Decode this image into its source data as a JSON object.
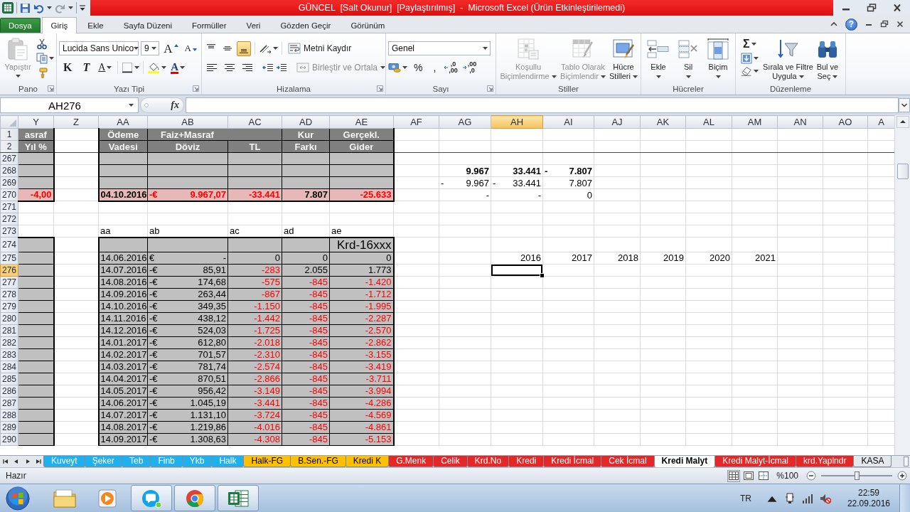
{
  "title_bar": {
    "title": "GÜNCEL  [Salt Okunur]  [Paylaştırılmış]  -  Microsoft Excel (Ürün Etkinleştirilemedi)",
    "quick_access": [
      {
        "kind": "save",
        "disabled": false
      },
      {
        "kind": "undo",
        "disabled": false
      },
      {
        "kind": "redo",
        "disabled": true
      }
    ]
  },
  "ribbon": {
    "tabs": [
      {
        "label": "Dosya",
        "kind": "file",
        "selected": false
      },
      {
        "label": "Giriş",
        "kind": "tab",
        "selected": true
      },
      {
        "label": "Ekle",
        "kind": "tab",
        "selected": false
      },
      {
        "label": "Sayfa Düzeni",
        "kind": "tab",
        "selected": false
      },
      {
        "label": "Formüller",
        "kind": "tab",
        "selected": false
      },
      {
        "label": "Veri",
        "kind": "tab",
        "selected": false
      },
      {
        "label": "Gözden Geçir",
        "kind": "tab",
        "selected": false
      },
      {
        "label": "Görünüm",
        "kind": "tab",
        "selected": false
      }
    ],
    "help": "?",
    "clipboard": {
      "label": "Pano",
      "launcher": true,
      "paste": {
        "label": "Yapıştır",
        "disabled": true
      }
    },
    "font": {
      "label": "Yazı Tipi",
      "launcher": true,
      "name": "Lucida Sans Unico",
      "size": "9",
      "buttons": {
        "grow_font": "A",
        "shrink_font": "A",
        "bold": "K",
        "italic": "T",
        "underline": "A",
        "font_color": "A"
      }
    },
    "alignment": {
      "label": "Hizalama",
      "launcher": true,
      "vertical": [
        {
          "selected": false
        },
        {
          "selected": false
        },
        {
          "selected": true
        }
      ],
      "horizontal": [
        {
          "selected": false
        },
        {
          "selected": false
        },
        {
          "selected": false
        }
      ],
      "wrap_text": {
        "label": "Metni Kaydır",
        "disabled": false
      },
      "merge": {
        "label": "Birleştir ve Ortala",
        "disabled": true
      }
    },
    "number": {
      "label": "Sayı",
      "launcher": true,
      "format": "Genel",
      "percent": "%",
      "comma": ",",
      "decimals": [
        {
          "lines": [
            ",0",
            ",00"
          ]
        },
        {
          "lines": [
            ",00",
            ",0"
          ]
        }
      ]
    },
    "styles": {
      "label": "Stiller",
      "buttons": [
        {
          "lines": [
            "Koşullu",
            "Biçimlendirme"
          ],
          "disabled": true
        },
        {
          "lines": [
            "Tablo Olarak",
            "Biçimlendir"
          ],
          "disabled": true
        },
        {
          "lines": [
            "Hücre",
            "Stilleri"
          ],
          "disabled": false
        }
      ]
    },
    "cells": {
      "label": "Hücreler",
      "buttons": [
        {
          "label": "Ekle"
        },
        {
          "label": "Sil"
        },
        {
          "label": "Biçim"
        }
      ]
    },
    "editing": {
      "label": "Düzenleme",
      "sum": "Σ",
      "buttons": [
        {
          "lines": [
            "Sırala ve Filtre",
            "Uygula"
          ]
        },
        {
          "lines": [
            "Bul ve",
            "Seç"
          ]
        }
      ]
    }
  },
  "formula_bar": {
    "name_box": "AH276",
    "function": "fx"
  },
  "sheet": {
    "columns": [
      {
        "label": "Y",
        "selected": false
      },
      {
        "label": "Z",
        "selected": false
      },
      {
        "label": "AA",
        "selected": false
      },
      {
        "label": "AB",
        "selected": false
      },
      {
        "label": "AC",
        "selected": false
      },
      {
        "label": "AD",
        "selected": false
      },
      {
        "label": "AE",
        "selected": false
      },
      {
        "label": "AF",
        "selected": false
      },
      {
        "label": "AG",
        "selected": false
      },
      {
        "label": "AH",
        "selected": true
      },
      {
        "label": "AI",
        "selected": false
      },
      {
        "label": "AJ",
        "selected": false
      },
      {
        "label": "AK",
        "selected": false
      },
      {
        "label": "AL",
        "selected": false
      },
      {
        "label": "AM",
        "selected": false
      },
      {
        "label": "AN",
        "selected": false
      },
      {
        "label": "AO",
        "selected": false
      },
      {
        "label": "A",
        "selected": false
      }
    ],
    "rows": [
      {
        "number": "1",
        "selected": false,
        "cells": [
          {
            "kind": "header",
            "text": "asraf"
          },
          null,
          {
            "kind": "header",
            "text": "Ödeme"
          },
          {
            "kind": "header",
            "text": "Faiz+Masraf",
            "merge_right": true
          },
          null,
          {
            "kind": "header",
            "text": "Kur"
          },
          {
            "kind": "header",
            "text": "Gerçekl."
          }
        ]
      },
      {
        "number": "2",
        "selected": false,
        "cells": [
          {
            "kind": "header",
            "text": "Yıl %"
          },
          null,
          {
            "kind": "header",
            "text": "Vadesi"
          },
          {
            "kind": "header",
            "text": "Döviz"
          },
          {
            "kind": "header",
            "text": "TL"
          },
          {
            "kind": "header",
            "text": "Farkı"
          },
          {
            "kind": "header",
            "text": "Gider"
          }
        ]
      },
      {
        "number": "267",
        "selected": false,
        "cells": [
          {
            "kind": "shaded"
          },
          null,
          {
            "kind": "shaded"
          },
          {
            "kind": "shaded"
          },
          {
            "kind": "shaded"
          },
          {
            "kind": "shaded"
          },
          {
            "kind": "shaded"
          }
        ]
      },
      {
        "number": "268",
        "selected": false,
        "cells": [
          {
            "kind": "shaded"
          },
          null,
          {
            "kind": "shaded"
          },
          {
            "kind": "shaded"
          },
          {
            "kind": "shaded"
          },
          {
            "kind": "shaded"
          },
          {
            "kind": "shaded"
          },
          null,
          {
            "kind": "strong",
            "text": "9.967"
          },
          {
            "kind": "strong",
            "text": "33.441"
          },
          {
            "kind": "strong",
            "sign": "-",
            "text": "7.807"
          }
        ]
      },
      {
        "number": "269",
        "selected": false,
        "cells": [
          {
            "kind": "shaded"
          },
          null,
          {
            "kind": "shaded"
          },
          {
            "kind": "shaded"
          },
          {
            "kind": "shaded"
          },
          {
            "kind": "shaded"
          },
          {
            "kind": "shaded"
          },
          null,
          {
            "kind": "plain",
            "sign": "-",
            "text": "9.967"
          },
          {
            "kind": "plain",
            "sign": "-",
            "text": "33.441"
          },
          {
            "kind": "plain",
            "text": "7.807"
          }
        ]
      },
      {
        "number": "270",
        "selected": false,
        "cells": [
          {
            "kind": "total",
            "text": "-4,00",
            "color": "#ff0000"
          },
          null,
          {
            "kind": "total",
            "text": "04.10.2016"
          },
          {
            "kind": "total",
            "sign": "-€",
            "text": "9.967,07",
            "color": "#ff0000"
          },
          {
            "kind": "total",
            "text": "-33.441",
            "color": "#ff0000"
          },
          {
            "kind": "total",
            "text": "7.807"
          },
          {
            "kind": "total",
            "text": "-25.633",
            "color": "#ff0000"
          },
          null,
          {
            "kind": "plain",
            "text": "-"
          },
          {
            "kind": "plain",
            "text": "-"
          },
          {
            "kind": "plain",
            "text": "0"
          }
        ]
      },
      {
        "number": "271",
        "selected": false
      },
      {
        "number": "272",
        "selected": false
      },
      {
        "number": "273",
        "selected": false,
        "cells": [
          null,
          null,
          {
            "kind": "label",
            "text": "aa"
          },
          {
            "kind": "label",
            "text": "ab"
          },
          {
            "kind": "label",
            "text": "ac"
          },
          {
            "kind": "label",
            "text": "ad"
          },
          {
            "kind": "label",
            "text": "ae"
          }
        ]
      },
      {
        "number": "274",
        "selected": false,
        "cells": [
          {
            "kind": "shaded"
          },
          null,
          {
            "kind": "shaded"
          },
          {
            "kind": "shaded"
          },
          {
            "kind": "shaded"
          },
          {
            "kind": "shaded"
          },
          {
            "kind": "note",
            "text": "Krd-16xxx"
          }
        ]
      },
      {
        "number": "275",
        "selected": false,
        "cells": [
          {
            "kind": "shaded"
          },
          null,
          {
            "kind": "shaded",
            "text": "14.06.2016"
          },
          {
            "kind": "shaded",
            "sign": "€",
            "text": "-"
          },
          {
            "kind": "shaded",
            "text": "0"
          },
          {
            "kind": "shaded",
            "text": "0"
          },
          {
            "kind": "shaded",
            "text": "0"
          },
          null,
          null,
          {
            "kind": "plain",
            "text": "2016"
          },
          {
            "kind": "plain",
            "text": "2017"
          },
          {
            "kind": "plain",
            "text": "2018"
          },
          {
            "kind": "plain",
            "text": "2019"
          },
          {
            "kind": "plain",
            "text": "2020"
          },
          {
            "kind": "plain",
            "text": "2021"
          }
        ]
      },
      {
        "number": "276",
        "selected": true,
        "cells": [
          {
            "kind": "shaded"
          },
          null,
          {
            "kind": "shaded",
            "text": "14.07.2016"
          },
          {
            "kind": "shaded",
            "sign": "-€",
            "text": "85,91"
          },
          {
            "kind": "shaded",
            "text": "-283",
            "color": "#ff0000"
          },
          {
            "kind": "shaded",
            "text": "2.055"
          },
          {
            "kind": "shaded",
            "text": "1.773"
          }
        ]
      },
      {
        "number": "277",
        "selected": false,
        "cells": [
          {
            "kind": "shaded"
          },
          null,
          {
            "kind": "shaded",
            "text": "14.08.2016"
          },
          {
            "kind": "shaded",
            "sign": "-€",
            "text": "174,68"
          },
          {
            "kind": "shaded",
            "text": "-575",
            "color": "#ff0000"
          },
          {
            "kind": "shaded",
            "text": "-845",
            "color": "#ff0000"
          },
          {
            "kind": "shaded",
            "text": "-1.420",
            "color": "#ff0000"
          }
        ]
      },
      {
        "number": "278",
        "selected": false,
        "cells": [
          {
            "kind": "shaded"
          },
          null,
          {
            "kind": "shaded",
            "text": "14.09.2016"
          },
          {
            "kind": "shaded",
            "sign": "-€",
            "text": "263,44"
          },
          {
            "kind": "shaded",
            "text": "-867",
            "color": "#ff0000"
          },
          {
            "kind": "shaded",
            "text": "-845",
            "color": "#ff0000"
          },
          {
            "kind": "shaded",
            "text": "-1.712",
            "color": "#ff0000"
          }
        ]
      },
      {
        "number": "279",
        "selected": false,
        "cells": [
          {
            "kind": "shaded"
          },
          null,
          {
            "kind": "shaded",
            "text": "14.10.2016"
          },
          {
            "kind": "shaded",
            "sign": "-€",
            "text": "349,35"
          },
          {
            "kind": "shaded",
            "text": "-1.150",
            "color": "#ff0000"
          },
          {
            "kind": "shaded",
            "text": "-845",
            "color": "#ff0000"
          },
          {
            "kind": "shaded",
            "text": "-1.995",
            "color": "#ff0000"
          }
        ]
      },
      {
        "number": "280",
        "selected": false,
        "cells": [
          {
            "kind": "shaded"
          },
          null,
          {
            "kind": "shaded",
            "text": "14.11.2016"
          },
          {
            "kind": "shaded",
            "sign": "-€",
            "text": "438,12"
          },
          {
            "kind": "shaded",
            "text": "-1.442",
            "color": "#ff0000"
          },
          {
            "kind": "shaded",
            "text": "-845",
            "color": "#ff0000"
          },
          {
            "kind": "shaded",
            "text": "-2.287",
            "color": "#ff0000"
          }
        ]
      },
      {
        "number": "281",
        "selected": false,
        "cells": [
          {
            "kind": "shaded"
          },
          null,
          {
            "kind": "shaded",
            "text": "14.12.2016"
          },
          {
            "kind": "shaded",
            "sign": "-€",
            "text": "524,03"
          },
          {
            "kind": "shaded",
            "text": "-1.725",
            "color": "#ff0000"
          },
          {
            "kind": "shaded",
            "text": "-845",
            "color": "#ff0000"
          },
          {
            "kind": "shaded",
            "text": "-2.570",
            "color": "#ff0000"
          }
        ]
      },
      {
        "number": "282",
        "selected": false,
        "cells": [
          {
            "kind": "shaded"
          },
          null,
          {
            "kind": "shaded",
            "text": "14.01.2017"
          },
          {
            "kind": "shaded",
            "sign": "-€",
            "text": "612,80"
          },
          {
            "kind": "shaded",
            "text": "-2.018",
            "color": "#ff0000"
          },
          {
            "kind": "shaded",
            "text": "-845",
            "color": "#ff0000"
          },
          {
            "kind": "shaded",
            "text": "-2.862",
            "color": "#ff0000"
          }
        ]
      },
      {
        "number": "283",
        "selected": false,
        "cells": [
          {
            "kind": "shaded"
          },
          null,
          {
            "kind": "shaded",
            "text": "14.02.2017"
          },
          {
            "kind": "shaded",
            "sign": "-€",
            "text": "701,57"
          },
          {
            "kind": "shaded",
            "text": "-2.310",
            "color": "#ff0000"
          },
          {
            "kind": "shaded",
            "text": "-845",
            "color": "#ff0000"
          },
          {
            "kind": "shaded",
            "text": "-3.155",
            "color": "#ff0000"
          }
        ]
      },
      {
        "number": "284",
        "selected": false,
        "cells": [
          {
            "kind": "shaded"
          },
          null,
          {
            "kind": "shaded",
            "text": "14.03.2017"
          },
          {
            "kind": "shaded",
            "sign": "-€",
            "text": "781,74"
          },
          {
            "kind": "shaded",
            "text": "-2.574",
            "color": "#ff0000"
          },
          {
            "kind": "shaded",
            "text": "-845",
            "color": "#ff0000"
          },
          {
            "kind": "shaded",
            "text": "-3.419",
            "color": "#ff0000"
          }
        ]
      },
      {
        "number": "285",
        "selected": false,
        "cells": [
          {
            "kind": "shaded"
          },
          null,
          {
            "kind": "shaded",
            "text": "14.04.2017"
          },
          {
            "kind": "shaded",
            "sign": "-€",
            "text": "870,51"
          },
          {
            "kind": "shaded",
            "text": "-2.866",
            "color": "#ff0000"
          },
          {
            "kind": "shaded",
            "text": "-845",
            "color": "#ff0000"
          },
          {
            "kind": "shaded",
            "text": "-3.711",
            "color": "#ff0000"
          }
        ]
      },
      {
        "number": "286",
        "selected": false,
        "cells": [
          {
            "kind": "shaded"
          },
          null,
          {
            "kind": "shaded",
            "text": "14.05.2017"
          },
          {
            "kind": "shaded",
            "sign": "-€",
            "text": "956,42"
          },
          {
            "kind": "shaded",
            "text": "-3.149",
            "color": "#ff0000"
          },
          {
            "kind": "shaded",
            "text": "-845",
            "color": "#ff0000"
          },
          {
            "kind": "shaded",
            "text": "-3.994",
            "color": "#ff0000"
          }
        ]
      },
      {
        "number": "287",
        "selected": false,
        "cells": [
          {
            "kind": "shaded"
          },
          null,
          {
            "kind": "shaded",
            "text": "14.06.2017"
          },
          {
            "kind": "shaded",
            "sign": "-€",
            "text": "1.045,19"
          },
          {
            "kind": "shaded",
            "text": "-3.441",
            "color": "#ff0000"
          },
          {
            "kind": "shaded",
            "text": "-845",
            "color": "#ff0000"
          },
          {
            "kind": "shaded",
            "text": "-4.286",
            "color": "#ff0000"
          }
        ]
      },
      {
        "number": "288",
        "selected": false,
        "cells": [
          {
            "kind": "shaded"
          },
          null,
          {
            "kind": "shaded",
            "text": "14.07.2017"
          },
          {
            "kind": "shaded",
            "sign": "-€",
            "text": "1.131,10"
          },
          {
            "kind": "shaded",
            "text": "-3.724",
            "color": "#ff0000"
          },
          {
            "kind": "shaded",
            "text": "-845",
            "color": "#ff0000"
          },
          {
            "kind": "shaded",
            "text": "-4.569",
            "color": "#ff0000"
          }
        ]
      },
      {
        "number": "289",
        "selected": false,
        "cells": [
          {
            "kind": "shaded"
          },
          null,
          {
            "kind": "shaded",
            "text": "14.08.2017"
          },
          {
            "kind": "shaded",
            "sign": "-€",
            "text": "1.219,86"
          },
          {
            "kind": "shaded",
            "text": "-4.016",
            "color": "#ff0000"
          },
          {
            "kind": "shaded",
            "text": "-845",
            "color": "#ff0000"
          },
          {
            "kind": "shaded",
            "text": "-4.861",
            "color": "#ff0000"
          }
        ]
      },
      {
        "number": "290",
        "selected": false,
        "cells": [
          {
            "kind": "shaded"
          },
          null,
          {
            "kind": "shaded",
            "text": "14.09.2017"
          },
          {
            "kind": "shaded",
            "sign": "-€",
            "text": "1.308,63"
          },
          {
            "kind": "shaded",
            "text": "-4.308",
            "color": "#ff0000"
          },
          {
            "kind": "shaded",
            "text": "-845",
            "color": "#ff0000"
          },
          {
            "kind": "shaded",
            "text": "-5.153",
            "color": "#ff0000"
          }
        ]
      }
    ]
  },
  "sheet_tabs": [
    {
      "label": "Kuveyt",
      "color": "#1fb0ee",
      "selected": false
    },
    {
      "label": "Şeker",
      "color": "#1fb0ee",
      "selected": false
    },
    {
      "label": "Teb",
      "color": "#1fb0ee",
      "selected": false
    },
    {
      "label": "Finb",
      "color": "#1fb0ee",
      "selected": false
    },
    {
      "label": "Ykb",
      "color": "#1fb0ee",
      "selected": false
    },
    {
      "label": "Halk",
      "color": "#1fb0ee",
      "selected": false
    },
    {
      "label": "Halk-FG",
      "color": "#ffc000",
      "selected": false
    },
    {
      "label": "B.Sen.-FG",
      "color": "#ffc000",
      "selected": false
    },
    {
      "label": "Kredi K",
      "color": "#ffc000",
      "selected": false
    },
    {
      "label": "G.Menk",
      "color": "#e42727",
      "selected": false
    },
    {
      "label": "Celik",
      "color": "#e42727",
      "selected": false
    },
    {
      "label": "Krd.No",
      "color": "#e42727",
      "selected": false
    },
    {
      "label": "Kredi",
      "color": "#e42727",
      "selected": false
    },
    {
      "label": "Kredi İcmal",
      "color": "#e42727",
      "selected": false
    },
    {
      "label": "Cek İcmal",
      "color": "#e42727",
      "selected": false
    },
    {
      "label": "Kredi Malyt",
      "selected": true
    },
    {
      "label": "Kredi Malyt-İcmal",
      "color": "#e42727",
      "selected": false
    },
    {
      "label": "krd.Yaplndr",
      "color": "#e42727",
      "selected": false
    },
    {
      "label": "KASA",
      "selected": false
    }
  ],
  "status_bar": {
    "text": "Hazır",
    "views": [
      {
        "selected": true
      },
      {
        "selected": false
      },
      {
        "selected": false
      }
    ],
    "zoom": "%100",
    "zoom_slider": {
      "level": 0.5
    }
  },
  "taskbar": {
    "apps": [
      {
        "kind": "folder",
        "running": false
      },
      {
        "kind": "media",
        "running": false
      },
      {
        "kind": "chat",
        "running": true
      },
      {
        "kind": "browser",
        "running": true
      },
      {
        "kind": "spreadsheet",
        "running": true
      }
    ],
    "language": "TR",
    "time": "22:59",
    "date": "22.09.2016"
  }
}
